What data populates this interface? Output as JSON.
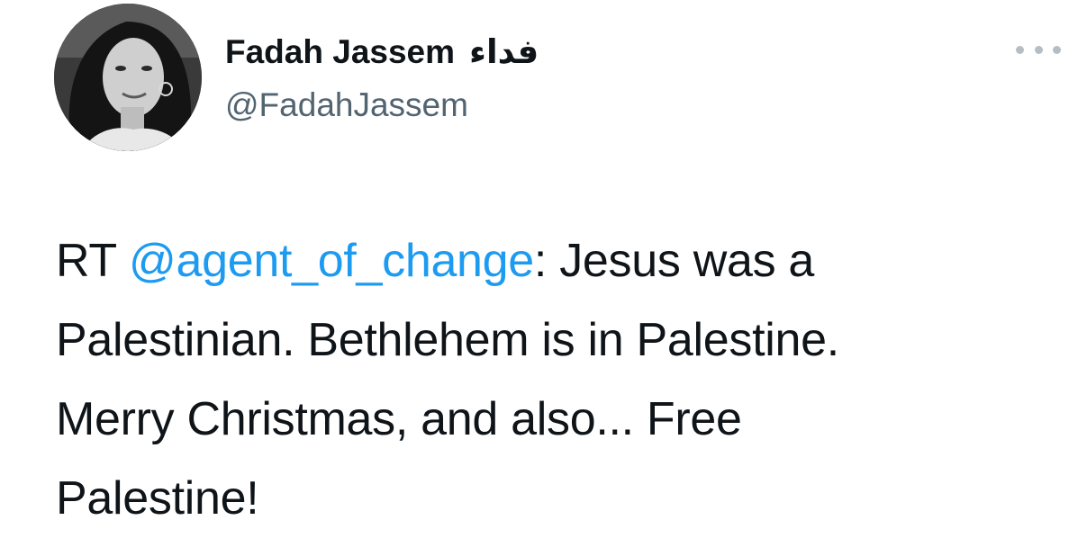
{
  "tweet": {
    "author": {
      "display_name": "Fadah Jassem",
      "display_name_arabic": "فداء",
      "handle": "@FadahJassem"
    },
    "more_icon": "more-horizontal-icon",
    "text": {
      "prefix": "RT ",
      "mention": "@agent_of_change",
      "line1_rest": ": Jesus was a",
      "line2": "Palestinian. Bethlehem is in Palestine.",
      "line3": "Merry Christmas, and also... Free",
      "line4": "Palestine!"
    },
    "colors": {
      "mention": "#1d9bf0",
      "handle": "#536471",
      "text": "#0f1419"
    }
  }
}
